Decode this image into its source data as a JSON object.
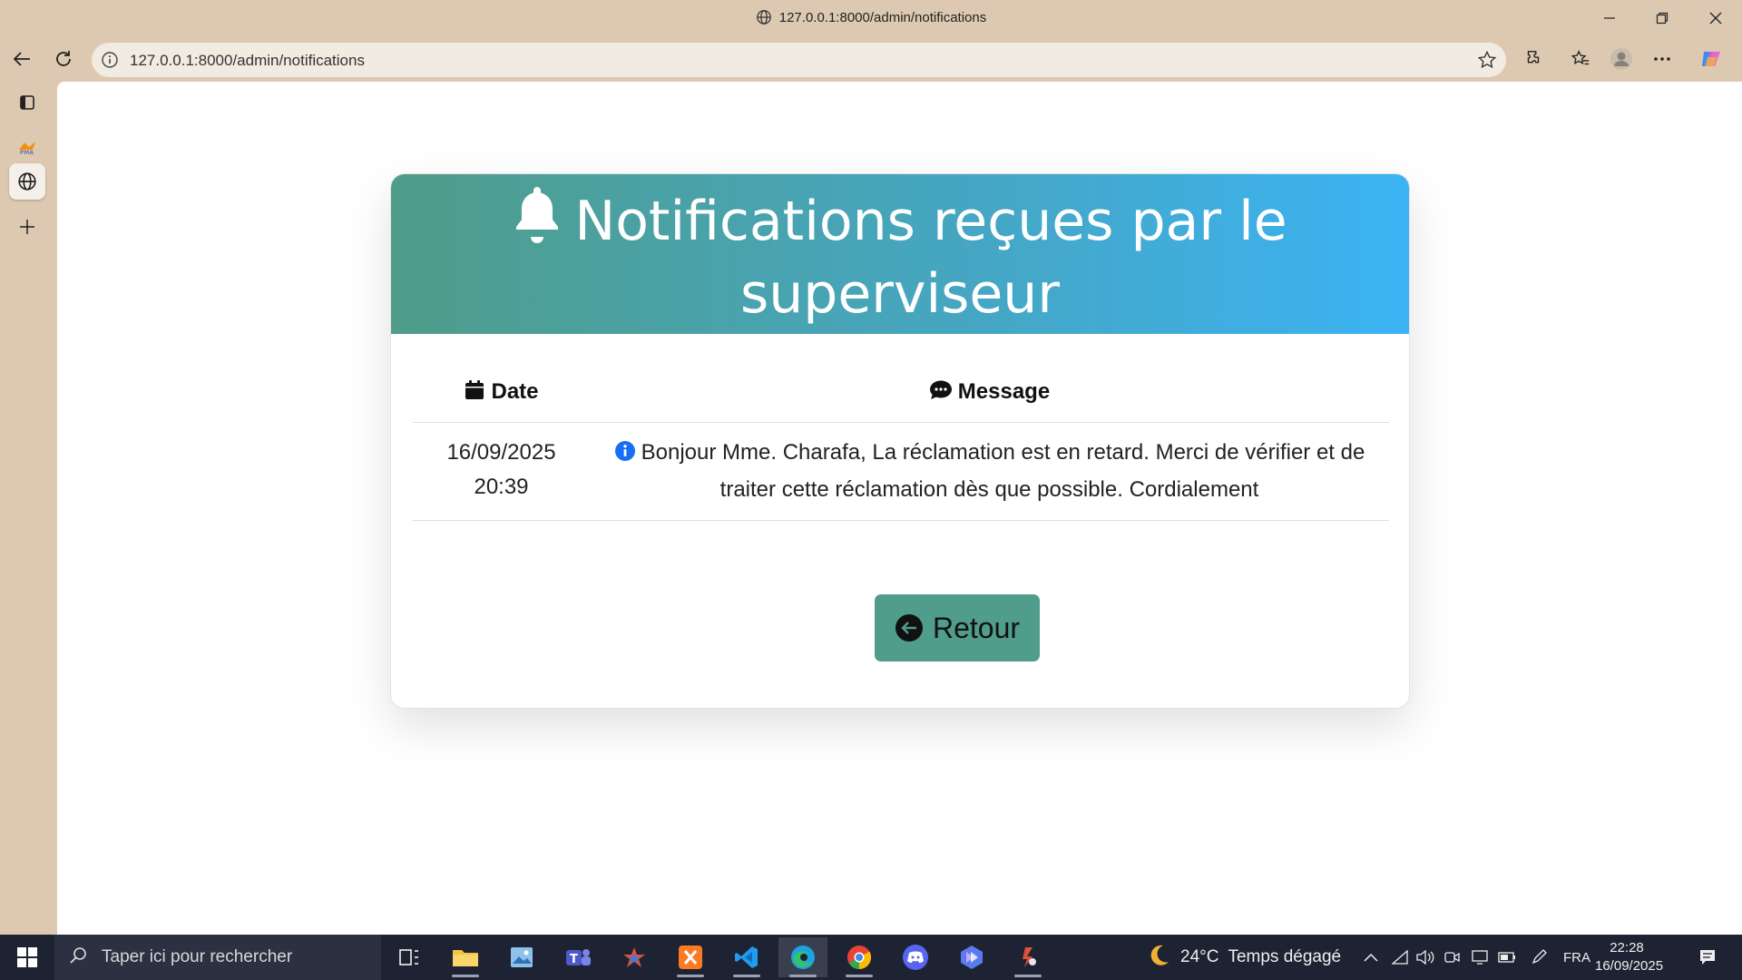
{
  "browser": {
    "window_title": "127.0.0.1:8000/admin/notifications",
    "url": "127.0.0.1:8000/admin/notifications"
  },
  "page": {
    "header_title": "Notifications reçues par le superviseur",
    "table": {
      "columns": [
        {
          "label": "Date",
          "icon": "calendar-icon"
        },
        {
          "label": "Message",
          "icon": "comment-icon"
        }
      ],
      "rows": [
        {
          "date": "16/09/2025",
          "time": "20:39",
          "message": "Bonjour Mme. Charafa, La réclamation est en retard. Merci de vérifier et de traiter cette réclamation dès que possible. Cordialement"
        }
      ]
    },
    "back_button_label": "Retour"
  },
  "taskbar": {
    "search_placeholder": "Taper ici pour rechercher",
    "weather_temp": "24°C",
    "weather_text": "Temps dégagé",
    "language": "FRA",
    "time": "22:28",
    "date": "16/09/2025"
  },
  "colors": {
    "header_gradient_start": "#4f9d8a",
    "header_gradient_end": "#3bb3f4",
    "button_bg": "#4f9d8a",
    "browser_chrome": "#ddc9b1",
    "taskbar": "#1e2333"
  }
}
